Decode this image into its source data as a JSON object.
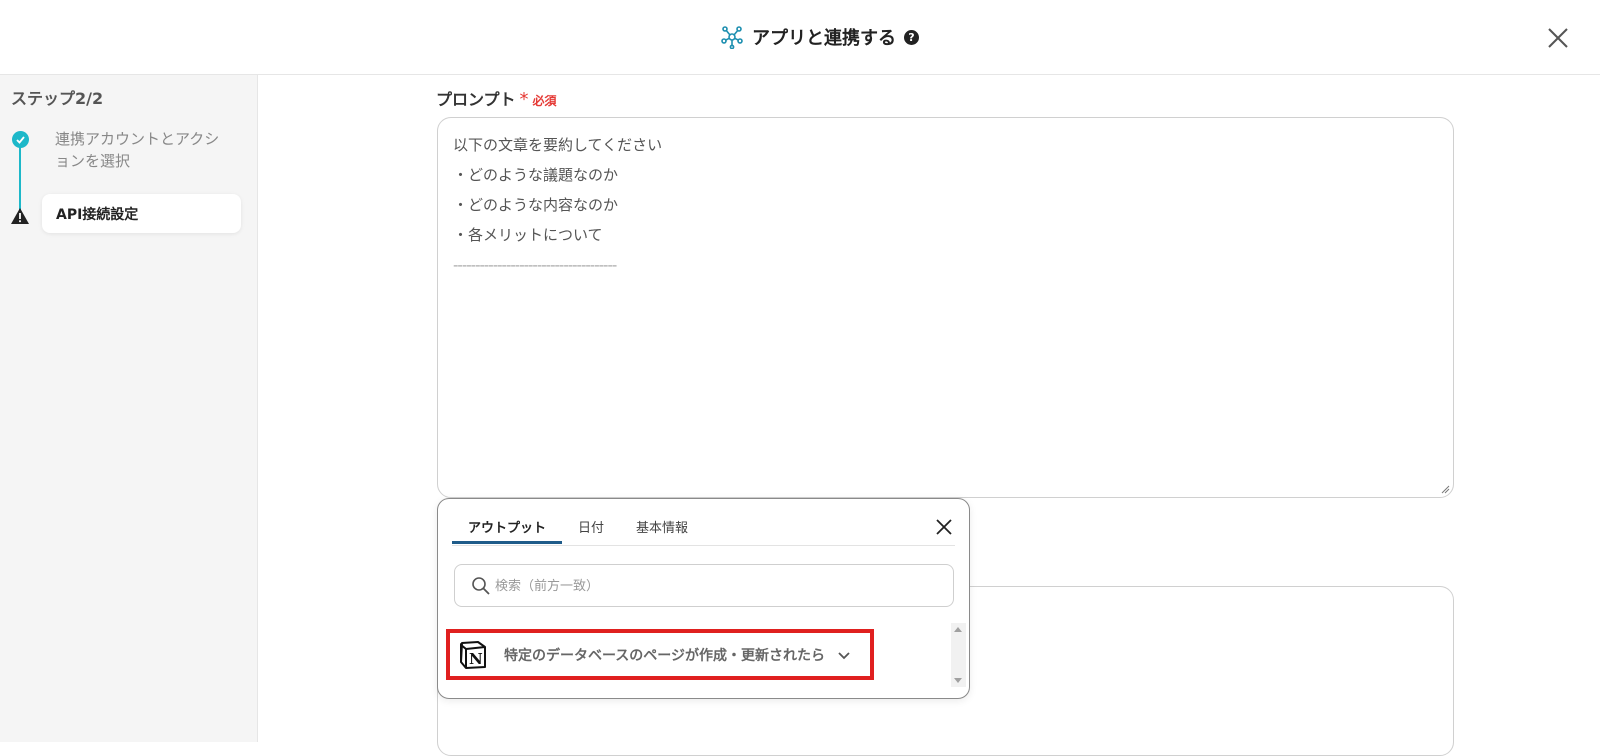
{
  "header": {
    "title": "アプリと連携する",
    "help_icon": "question-circle-icon",
    "close_icon": "close-icon"
  },
  "sidebar": {
    "step_label": "ステップ2/2",
    "steps": [
      {
        "label": "連携アカウントとアクションを選択",
        "status": "done",
        "icon": "check-circle-icon"
      },
      {
        "label": "API接続設定",
        "status": "warning",
        "icon": "warning-triangle-icon"
      }
    ]
  },
  "prompt_field": {
    "label": "プロンプト",
    "required_label": "必須",
    "lines": [
      "以下の文章を要約してください",
      "・どのような議題なのか",
      "・どのような内容なのか",
      "・各メリットについて",
      "-------------------------------------"
    ]
  },
  "output_popup": {
    "tabs": [
      "アウトプット",
      "日付",
      "基本情報"
    ],
    "active_tab": 0,
    "search_placeholder": "検索（前方一致）",
    "search_value": "",
    "items": [
      {
        "label": "特定のデータベースのページが作成・更新されたら",
        "icon": "notion-icon"
      }
    ]
  },
  "colors": {
    "accent_teal": "#1db8c9",
    "required_red": "#e53935",
    "highlight_red": "#e0201f",
    "tab_underline": "#1f5c8a"
  }
}
